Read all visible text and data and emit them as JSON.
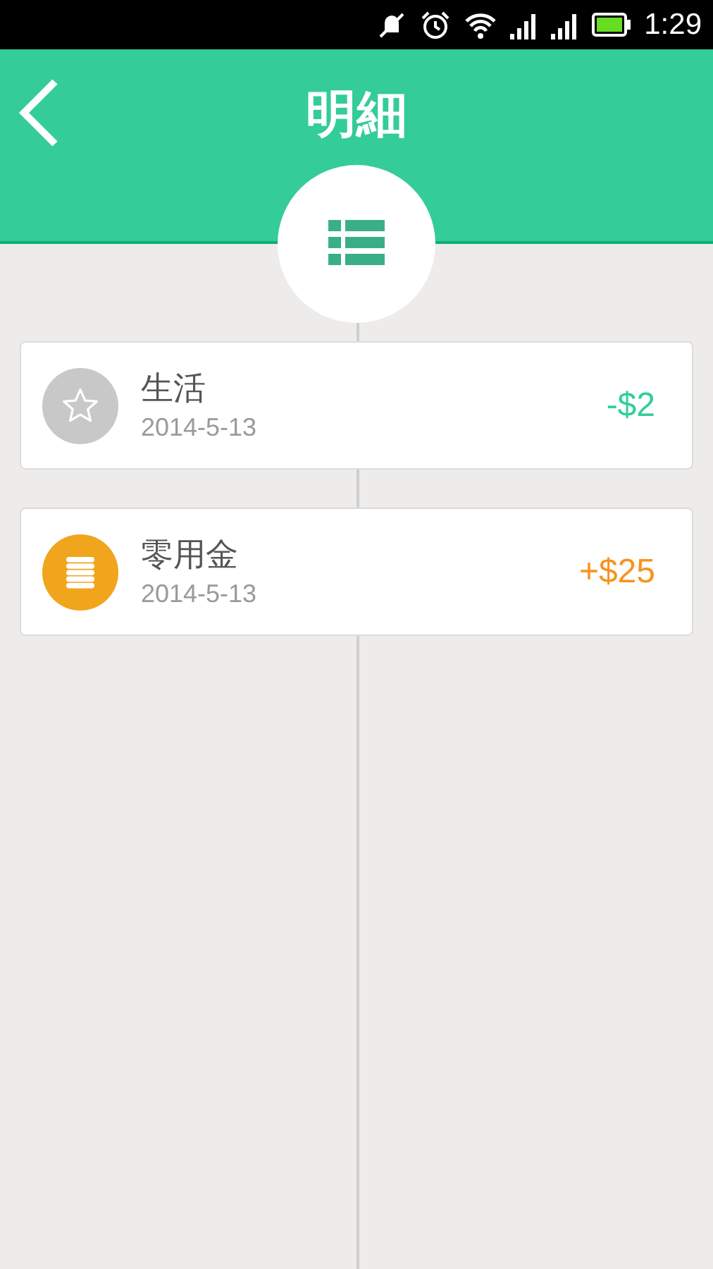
{
  "status_bar": {
    "time": "1:29"
  },
  "header": {
    "title": "明細"
  },
  "entries": [
    {
      "kind": "expense",
      "name": "生活",
      "date": "2014-5-13",
      "amount": "-$2",
      "color": "#c8c8c8"
    },
    {
      "kind": "income",
      "name": "零用金",
      "date": "2014-5-13",
      "amount": "+$25",
      "color": "#f0a51c"
    }
  ]
}
